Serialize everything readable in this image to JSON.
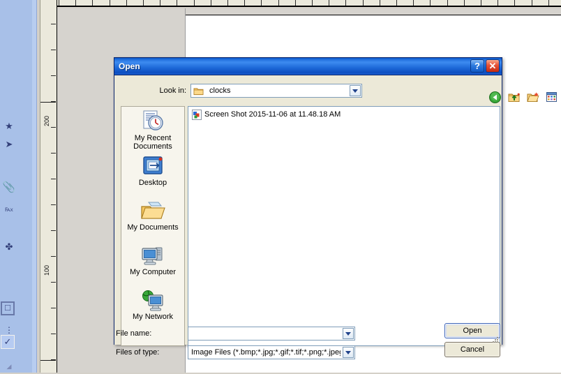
{
  "background_app": {
    "name": "drawing-application",
    "ruler": {
      "vertical_labels": [
        "200",
        "100"
      ],
      "orientation": "vertical",
      "units": "points"
    },
    "tool_palette": {
      "icons": [
        {
          "name": "star-tool-icon",
          "glyph": "★"
        },
        {
          "name": "pointer-tool-icon",
          "glyph": "➤"
        },
        {
          "name": "paperclip-tool-icon",
          "glyph": "📎"
        },
        {
          "name": "text-tool-icon",
          "glyph": "≓"
        },
        {
          "name": "crosshair-tool-icon",
          "glyph": "✤"
        },
        {
          "name": "rectangle-tool-icon",
          "glyph": "□"
        },
        {
          "name": "ellipsis-tool-icon",
          "glyph": "⋮"
        },
        {
          "name": "check-tool-icon",
          "glyph": "✔"
        }
      ]
    }
  },
  "dialog": {
    "title": "Open",
    "titlebar": {
      "help_label": "?",
      "close_label": "✕"
    },
    "lookin": {
      "label": "Look in:",
      "value": "clocks",
      "icon": "folder-icon"
    },
    "nav_toolbar": [
      {
        "name": "back-button",
        "tooltip": "Back"
      },
      {
        "name": "up-one-level-button",
        "tooltip": "Up One Level"
      },
      {
        "name": "new-folder-button",
        "tooltip": "Create New Folder"
      },
      {
        "name": "views-button",
        "tooltip": "Views"
      }
    ],
    "places": [
      {
        "label": "My Recent Documents",
        "icon": "recent-documents-icon"
      },
      {
        "label": "Desktop",
        "icon": "desktop-icon"
      },
      {
        "label": "My Documents",
        "icon": "my-documents-icon"
      },
      {
        "label": "My Computer",
        "icon": "my-computer-icon"
      },
      {
        "label": "My Network",
        "icon": "my-network-icon"
      }
    ],
    "files": [
      {
        "name": "Screen Shot 2015-11-06 at 11.48.18 AM",
        "icon": "image-file-icon"
      }
    ],
    "filename": {
      "label": "File name:",
      "value": "",
      "placeholder": ""
    },
    "filetype": {
      "label": "Files of type:",
      "value": "Image Files (*.bmp;*.jpg;*.gif;*.tif;*.png;*.jpeg)"
    },
    "buttons": {
      "open": "Open",
      "cancel": "Cancel"
    }
  },
  "colors": {
    "titlebar_blue": "#1f6ddc",
    "dialog_face": "#ece9d8",
    "places_face": "#f7f5ed",
    "field_border": "#7f9db9",
    "palette_blue": "#a8c0e8",
    "ruler_face": "#ebe9dc",
    "canvas_gray": "#d6d3ce"
  }
}
